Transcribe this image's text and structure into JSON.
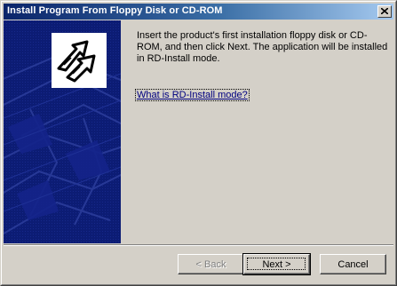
{
  "window": {
    "title": "Install Program From Floppy Disk or CD-ROM",
    "close_icon": "close-icon"
  },
  "content": {
    "instructions": "Insert the product's first installation floppy disk or CD-ROM, and then click Next. The application will be installed in RD-Install mode.",
    "help_link": "What is RD-Install mode?"
  },
  "buttons": {
    "back": "< Back",
    "next": "Next >",
    "cancel": "Cancel"
  },
  "colors": {
    "title_gradient_start": "#0a246a",
    "side_panel": "#0b1a6e",
    "face": "#d4d0c8",
    "link": "#000080"
  }
}
